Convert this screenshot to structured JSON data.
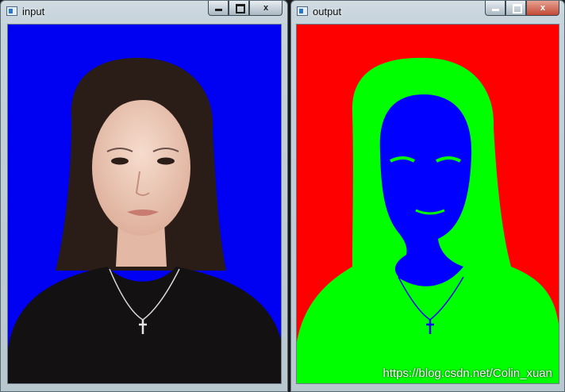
{
  "windows": [
    {
      "id": "input",
      "title": "input",
      "controls": {
        "minimize": "minimize",
        "maximize": "maximize",
        "close": "x"
      }
    },
    {
      "id": "output",
      "title": "output",
      "controls": {
        "minimize": "minimize",
        "maximize": "maximize",
        "close": "x"
      }
    }
  ],
  "watermark": "https://blog.csdn.net/Colin_xuan",
  "colors": {
    "input_background": "#0000f3",
    "output_background": "#ff0000",
    "output_person": "#00ff00",
    "output_features": "#0000ff",
    "hair": "#2a1c16",
    "skin": "#f0cfc0",
    "shirt": "#141112"
  },
  "icons": [
    "app-window-icon",
    "minimize-icon",
    "maximize-icon",
    "close-icon"
  ]
}
